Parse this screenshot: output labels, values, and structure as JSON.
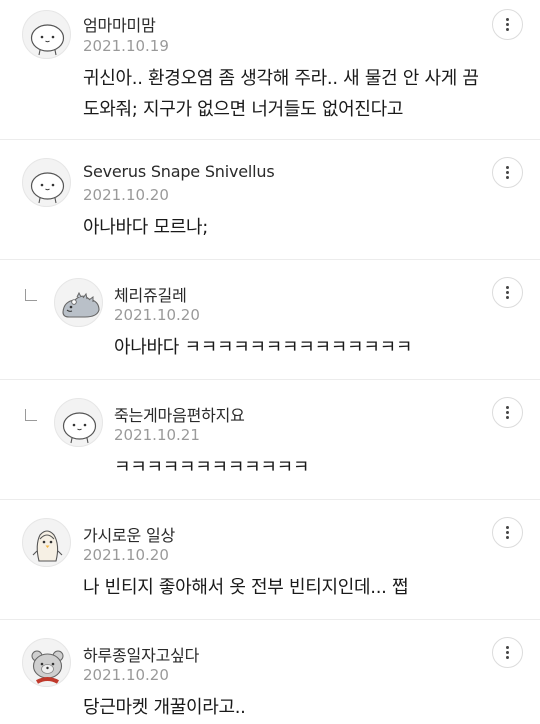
{
  "comments": [
    {
      "author": "엄마마미맘",
      "date": "2021.10.19",
      "lines": [
        "귀신아.. 환경오염 좀 생각해 주라.. 새 물건 안 사게 끔",
        "도와줘; 지구가 없으면 너거들도 없어진다고"
      ],
      "is_reply": false,
      "avatar_icon": "round-blob-face-icon"
    },
    {
      "author": "Severus Snape Snivellus",
      "date": "2021.10.20",
      "lines": [
        "아나바다 모르나;"
      ],
      "is_reply": false,
      "avatar_icon": "round-blob-face-icon"
    },
    {
      "author": "체리쥬길레",
      "date": "2021.10.20",
      "lines": [
        "아나바다 ㅋㅋㅋㅋㅋㅋㅋㅋㅋㅋㅋㅋㅋㅋ"
      ],
      "is_reply": true,
      "avatar_icon": "dinosaur-icon"
    },
    {
      "author": "죽는게마음편하지요",
      "date": "2021.10.21",
      "lines": [
        "ㅋㅋㅋㅋㅋㅋㅋㅋㅋㅋㅋㅋ"
      ],
      "is_reply": true,
      "avatar_icon": "round-blob-face-icon"
    },
    {
      "author": "가시로운 일상",
      "date": "2021.10.20",
      "lines": [
        "나 빈티지 좋아해서 옷 전부 빈티지인데... 쩝"
      ],
      "is_reply": false,
      "avatar_icon": "penguin-icon"
    },
    {
      "author": "하루종일자고싶다",
      "date": "2021.10.20",
      "lines": [
        "당근마켓 개꿀이라고.."
      ],
      "is_reply": false,
      "avatar_icon": "bear-icon"
    }
  ]
}
